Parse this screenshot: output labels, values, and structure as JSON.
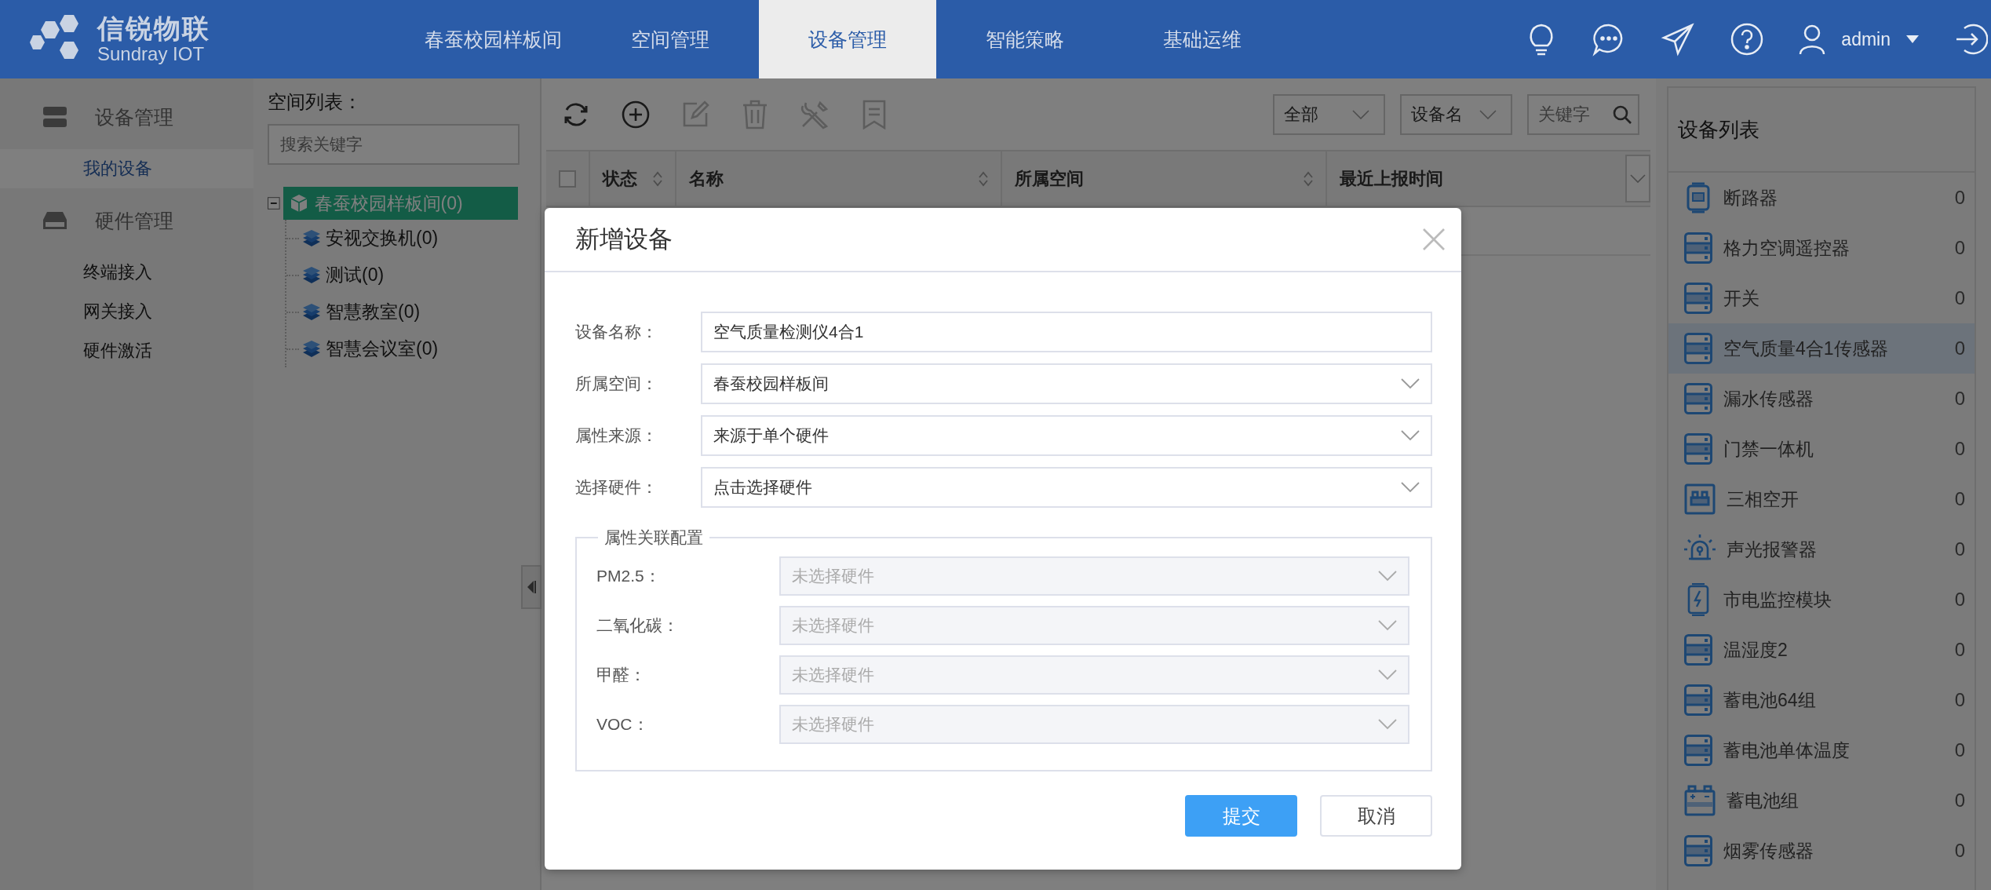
{
  "header": {
    "logo": {
      "name": "信锐物联",
      "subtitle": "Sundray IOT"
    },
    "nav": [
      {
        "label": "春蚕校园样板间",
        "selected": false
      },
      {
        "label": "空间管理",
        "selected": false
      },
      {
        "label": "设备管理",
        "selected": true
      },
      {
        "label": "智能策略",
        "selected": false
      },
      {
        "label": "基础运维",
        "selected": false
      }
    ],
    "user": "admin"
  },
  "sidebar": {
    "groups": [
      {
        "label": "设备管理",
        "kind": "server",
        "items": [
          {
            "label": "我的设备",
            "selected": true
          }
        ]
      },
      {
        "label": "硬件管理",
        "kind": "drive",
        "items": [
          {
            "label": "终端接入",
            "selected": false
          },
          {
            "label": "网关接入",
            "selected": false
          },
          {
            "label": "硬件激活",
            "selected": false
          }
        ]
      }
    ]
  },
  "space_tree": {
    "title": "空间列表：",
    "search": {
      "placeholder": "搜索关键字"
    },
    "root": {
      "label": "春蚕校园样板间(0)",
      "expanded": true,
      "selected": true,
      "children": [
        {
          "label": "安视交换机(0)",
          "selected": false
        },
        {
          "label": "测试(0)",
          "selected": false
        },
        {
          "label": "智慧教室(0)",
          "selected": false
        },
        {
          "label": "智慧会议室(0)",
          "selected": false
        }
      ]
    }
  },
  "toolbar": {
    "buttons": [
      {
        "kind": "refresh",
        "disabled": false
      },
      {
        "kind": "add",
        "disabled": false
      },
      {
        "kind": "edit",
        "disabled": true
      },
      {
        "kind": "delete",
        "disabled": true
      },
      {
        "kind": "tools",
        "disabled": true
      },
      {
        "kind": "bookmark",
        "disabled": true
      }
    ],
    "filters": [
      {
        "kind": "select",
        "value": "全部"
      },
      {
        "kind": "select",
        "value": "设备名"
      },
      {
        "kind": "search",
        "placeholder": "关键字"
      }
    ]
  },
  "table": {
    "select_all_checked": false,
    "columns": [
      {
        "label": "状态",
        "sortable": true
      },
      {
        "label": "名称",
        "sortable": true
      },
      {
        "label": "所属空间",
        "sortable": true
      },
      {
        "label": "最近上报时间",
        "sortable": false
      }
    ]
  },
  "device_list": {
    "title": "设备列表",
    "items": [
      {
        "name": "断路器",
        "count": "0",
        "kind": "breaker",
        "selected": false
      },
      {
        "name": "格力空调遥控器",
        "count": "0",
        "kind": "server",
        "selected": false
      },
      {
        "name": "开关",
        "count": "0",
        "kind": "server",
        "selected": false
      },
      {
        "name": "空气质量4合1传感器",
        "count": "0",
        "kind": "server",
        "selected": true
      },
      {
        "name": "漏水传感器",
        "count": "0",
        "kind": "server",
        "selected": false
      },
      {
        "name": "门禁一体机",
        "count": "0",
        "kind": "server",
        "selected": false
      },
      {
        "name": "三相空开",
        "count": "0",
        "kind": "panel",
        "selected": false
      },
      {
        "name": "声光报警器",
        "count": "0",
        "kind": "alarm",
        "selected": false
      },
      {
        "name": "市电监控模块",
        "count": "0",
        "kind": "power",
        "selected": false
      },
      {
        "name": "温湿度2",
        "count": "0",
        "kind": "server",
        "selected": false
      },
      {
        "name": "蓄电池64组",
        "count": "0",
        "kind": "server",
        "selected": false
      },
      {
        "name": "蓄电池单体温度",
        "count": "0",
        "kind": "server",
        "selected": false
      },
      {
        "name": "蓄电池组",
        "count": "0",
        "kind": "battery",
        "selected": false
      },
      {
        "name": "烟雾传感器",
        "count": "0",
        "kind": "server",
        "selected": false
      }
    ]
  },
  "dialog": {
    "title": "新增设备",
    "fields": [
      {
        "label": "设备名称：",
        "kind": "input",
        "value": "空气质量检测仪4合1"
      },
      {
        "label": "所属空间：",
        "kind": "select",
        "value": "春蚕校园样板间"
      },
      {
        "label": "属性来源：",
        "kind": "select",
        "value": "来源于单个硬件"
      },
      {
        "label": "选择硬件：",
        "kind": "select",
        "value": "点击选择硬件"
      }
    ],
    "fieldset": {
      "legend": "属性关联配置",
      "fields": [
        {
          "label": "PM2.5：",
          "placeholder": "未选择硬件",
          "disabled": true
        },
        {
          "label": "二氧化碳：",
          "placeholder": "未选择硬件",
          "disabled": true
        },
        {
          "label": "甲醛：",
          "placeholder": "未选择硬件",
          "disabled": true
        },
        {
          "label": "VOC：",
          "placeholder": "未选择硬件",
          "disabled": true
        }
      ]
    },
    "buttons": [
      {
        "label": "提交",
        "kind": "primary"
      },
      {
        "label": "取消",
        "kind": "default"
      }
    ]
  }
}
